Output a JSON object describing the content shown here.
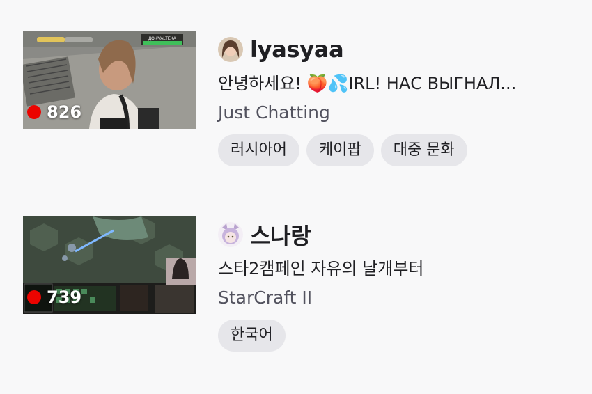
{
  "streams": [
    {
      "channel": "lyasyaa",
      "title": "안녕하세요! 🍑💦IRL! НАС ВЫГНАЛ...",
      "category": "Just Chatting",
      "viewers": "826",
      "tags": [
        "러시아어",
        "케이팝",
        "대중 문화"
      ],
      "overlay": {
        "top_banner": "ДО #VALTEKA"
      }
    },
    {
      "channel": "스나랑",
      "title": "스타2캠페인 자유의 날개부터",
      "category": "StarCraft II",
      "viewers": "739",
      "tags": [
        "한국어"
      ]
    }
  ],
  "colors": {
    "live": "#eb0400",
    "tag_bg": "#e6e6ea",
    "bg": "#f8f8f9"
  }
}
